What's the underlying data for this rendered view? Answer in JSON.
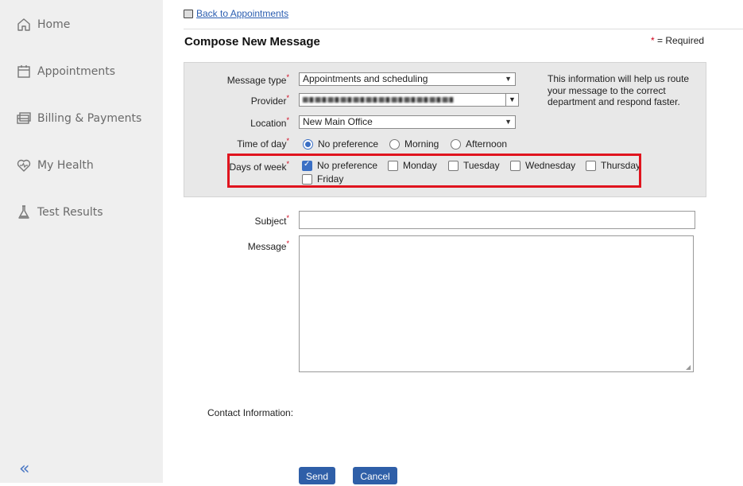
{
  "sidebar": {
    "items": [
      {
        "label": "Home",
        "icon": "home-icon"
      },
      {
        "label": "Appointments",
        "icon": "calendar-icon"
      },
      {
        "label": "Billing & Payments",
        "icon": "billing-icon"
      },
      {
        "label": "My Health",
        "icon": "heart-icon"
      },
      {
        "label": "Test Results",
        "icon": "flask-icon"
      }
    ],
    "collapse_label": "«"
  },
  "header": {
    "back_link": "Back to Appointments",
    "title": "Compose New Message",
    "required_asterisk": "*",
    "required_text": "= Required"
  },
  "form": {
    "message_type": {
      "label": "Message type",
      "value": "Appointments and scheduling"
    },
    "provider": {
      "label": "Provider"
    },
    "location": {
      "label": "Location",
      "value": "New Main Office"
    },
    "time_of_day": {
      "label": "Time of day",
      "options": [
        {
          "label": "No preference",
          "selected": true
        },
        {
          "label": "Morning",
          "selected": false
        },
        {
          "label": "Afternoon",
          "selected": false
        }
      ]
    },
    "days_of_week": {
      "label": "Days of week",
      "options": [
        {
          "label": "No preference",
          "checked": true
        },
        {
          "label": "Monday",
          "checked": false
        },
        {
          "label": "Tuesday",
          "checked": false
        },
        {
          "label": "Wednesday",
          "checked": false
        },
        {
          "label": "Thursday",
          "checked": false
        },
        {
          "label": "Friday",
          "checked": false
        }
      ]
    },
    "info_text": "This information will help us route your message to the correct department and respond faster.",
    "subject": {
      "label": "Subject",
      "value": ""
    },
    "message": {
      "label": "Message",
      "value": ""
    },
    "contact_label": "Contact Information:"
  },
  "buttons": {
    "send": "Send",
    "cancel": "Cancel"
  },
  "colors": {
    "accent": "#2f5fa8",
    "required": "#d0021b",
    "highlight": "#e0141e"
  }
}
